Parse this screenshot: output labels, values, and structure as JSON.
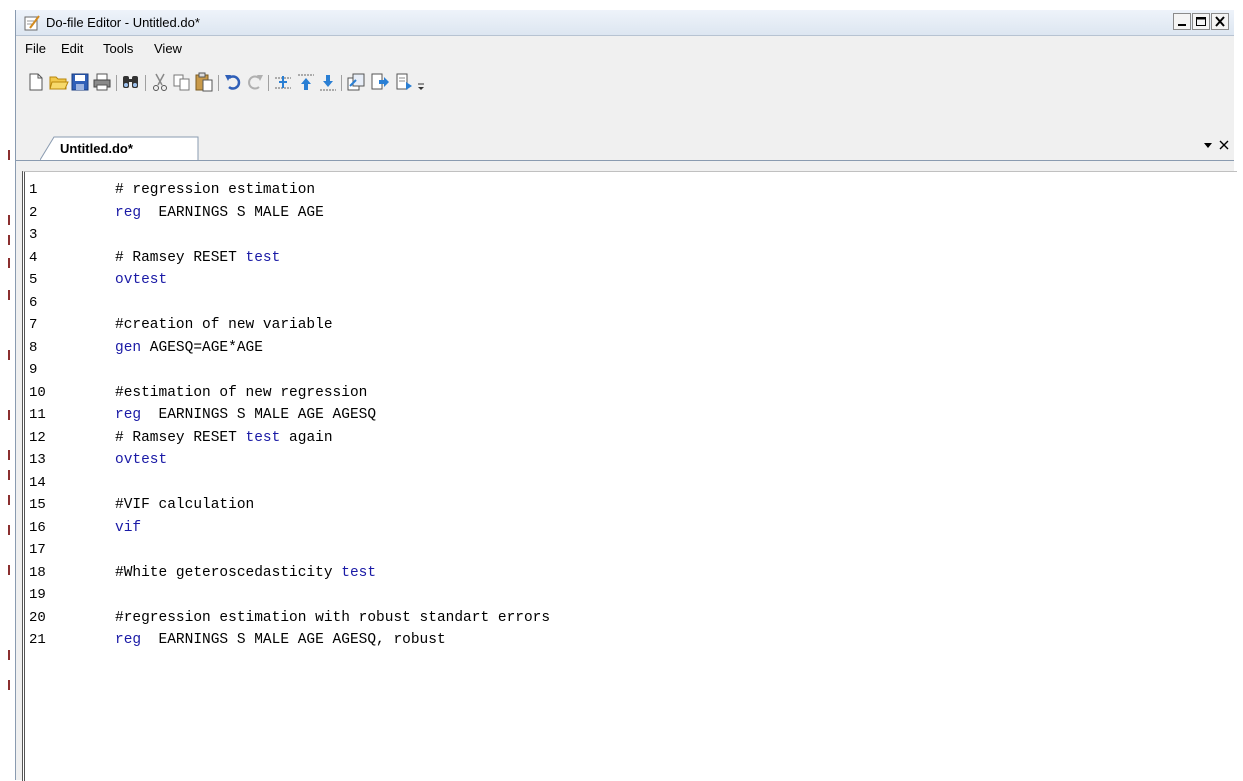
{
  "window": {
    "title": "Do-file Editor - Untitled.do*"
  },
  "menu": {
    "items": [
      "File",
      "Edit",
      "Tools",
      "View"
    ]
  },
  "toolbar": {
    "buttons": [
      "new-file-icon",
      "open-folder-icon",
      "save-icon",
      "print-icon",
      "find-icon",
      "cut-icon",
      "copy-icon",
      "paste-icon",
      "undo-icon",
      "redo-icon",
      "toggle-bookmark-icon",
      "previous-bookmark-icon",
      "next-bookmark-icon",
      "do-icon",
      "run-icon",
      "execute-selection-icon",
      "toolbar-overflow-icon"
    ]
  },
  "tab": {
    "label": "Untitled.do*"
  },
  "editor": {
    "lines": [
      {
        "num": "1",
        "tokens": [
          {
            "t": "# regression estimation",
            "k": false
          }
        ]
      },
      {
        "num": "2",
        "tokens": [
          {
            "t": "reg",
            "k": true
          },
          {
            "t": "  EARNINGS S MALE AGE",
            "k": false
          }
        ]
      },
      {
        "num": "3",
        "tokens": []
      },
      {
        "num": "4",
        "tokens": [
          {
            "t": "# Ramsey RESET ",
            "k": false
          },
          {
            "t": "test",
            "k": true
          }
        ]
      },
      {
        "num": "5",
        "tokens": [
          {
            "t": "ovtest",
            "k": true
          }
        ]
      },
      {
        "num": "6",
        "tokens": []
      },
      {
        "num": "7",
        "tokens": [
          {
            "t": "#creation of new variable",
            "k": false
          }
        ]
      },
      {
        "num": "8",
        "tokens": [
          {
            "t": "gen",
            "k": true
          },
          {
            "t": " AGESQ=AGE*AGE",
            "k": false
          }
        ]
      },
      {
        "num": "9",
        "tokens": []
      },
      {
        "num": "10",
        "tokens": [
          {
            "t": "#estimation of new regression",
            "k": false
          }
        ]
      },
      {
        "num": "11",
        "tokens": [
          {
            "t": "reg",
            "k": true
          },
          {
            "t": "  EARNINGS S MALE AGE AGESQ",
            "k": false
          }
        ]
      },
      {
        "num": "12",
        "tokens": [
          {
            "t": "# Ramsey RESET ",
            "k": false
          },
          {
            "t": "test",
            "k": true
          },
          {
            "t": " again",
            "k": false
          }
        ]
      },
      {
        "num": "13",
        "tokens": [
          {
            "t": "ovtest",
            "k": true
          }
        ]
      },
      {
        "num": "14",
        "tokens": []
      },
      {
        "num": "15",
        "tokens": [
          {
            "t": "#VIF calculation",
            "k": false
          }
        ]
      },
      {
        "num": "16",
        "tokens": [
          {
            "t": "vif",
            "k": true
          }
        ]
      },
      {
        "num": "17",
        "tokens": []
      },
      {
        "num": "18",
        "tokens": [
          {
            "t": "#White geteroscedasticity ",
            "k": false
          },
          {
            "t": "test",
            "k": true
          }
        ]
      },
      {
        "num": "19",
        "tokens": []
      },
      {
        "num": "20",
        "tokens": [
          {
            "t": "#regression estimation with robust standart errors",
            "k": false
          }
        ]
      },
      {
        "num": "21",
        "tokens": [
          {
            "t": "reg",
            "k": true
          },
          {
            "t": "  EARNINGS S MALE AGE AGESQ, robust",
            "k": false
          }
        ]
      }
    ]
  },
  "colors": {
    "keyword": "#1a1aa6",
    "text": "#000000"
  }
}
